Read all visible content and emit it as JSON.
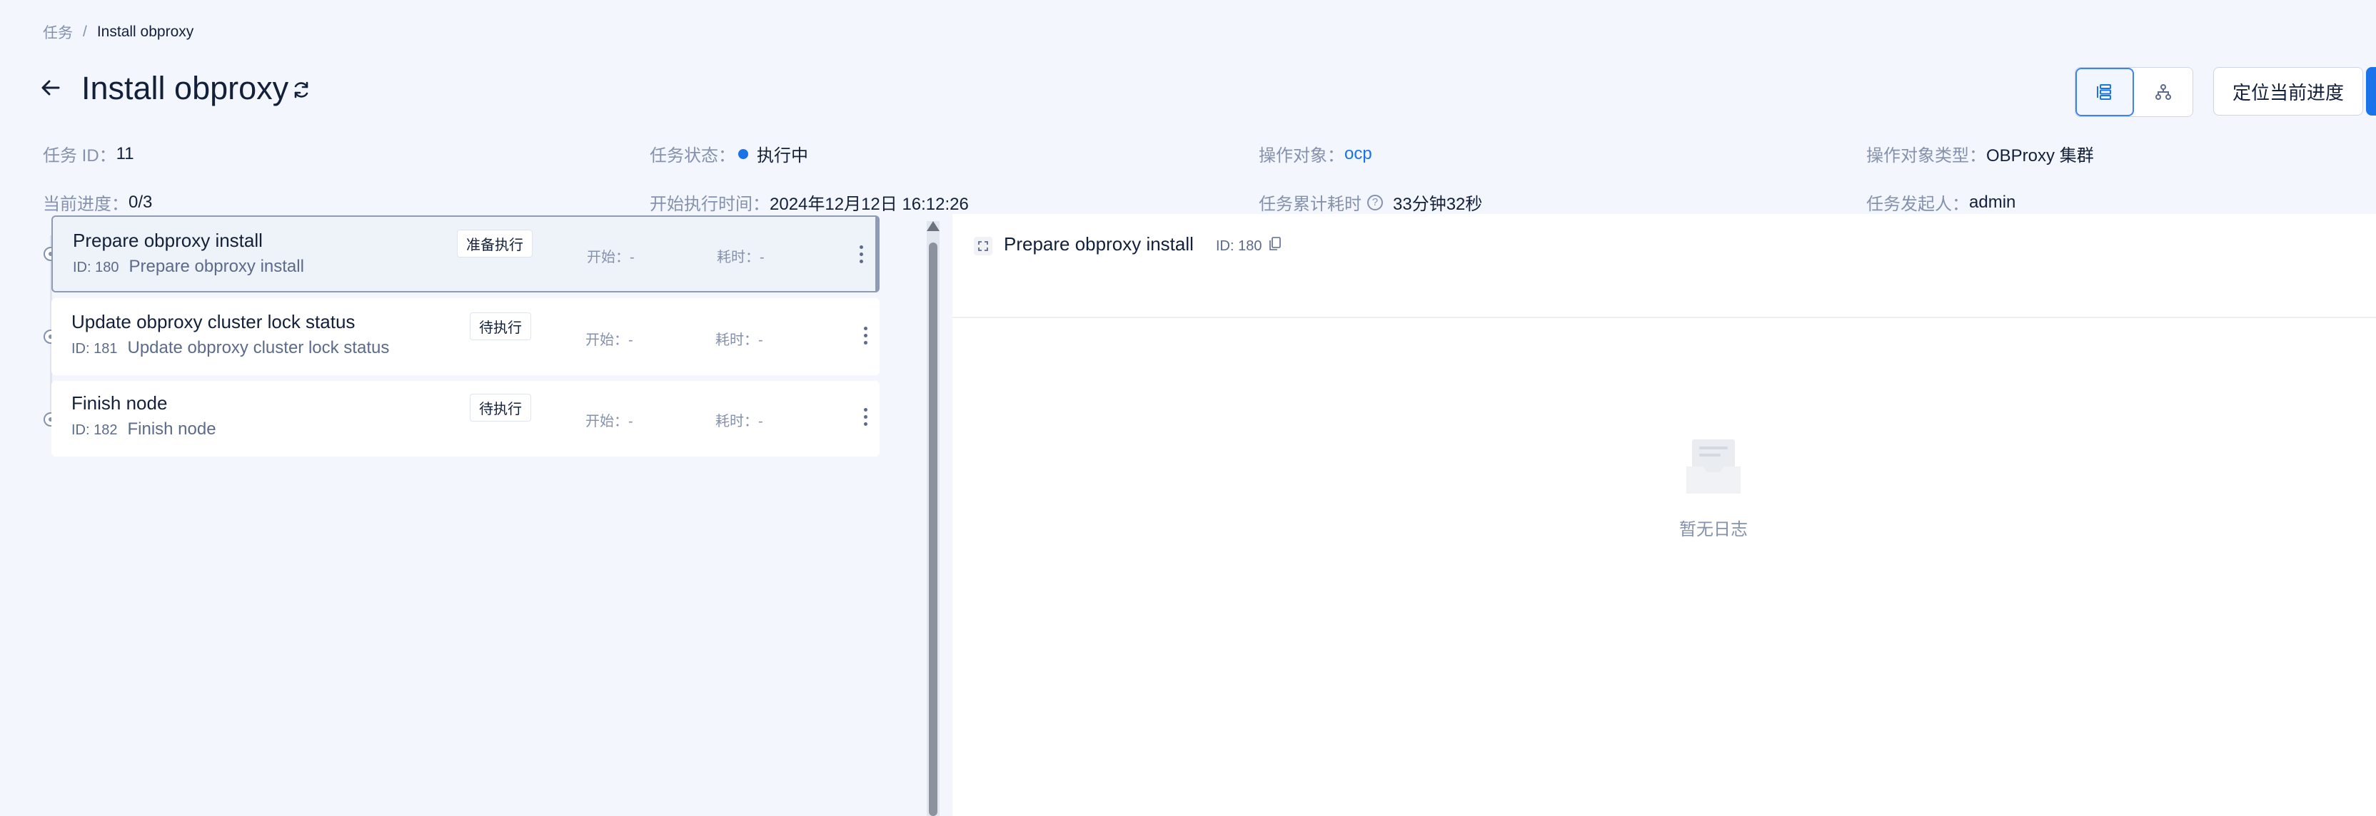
{
  "breadcrumb": {
    "parent": "任务",
    "sep": "/",
    "current": "Install obproxy"
  },
  "header": {
    "title": "Install obproxy",
    "locate_label": "定位当前进度"
  },
  "info": {
    "task_id_label": "任务 ID：",
    "task_id": "11",
    "status_label": "任务状态：",
    "status": "执行中",
    "target_label": "操作对象：",
    "target": "ocp",
    "target_type_label": "操作对象类型：",
    "target_type": "OBProxy 集群",
    "progress_label": "当前进度：",
    "progress": "0/3",
    "start_label": "开始执行时间：",
    "start": "2024年12月12日 16:12:26",
    "elapsed_label": "任务累计耗时",
    "elapsed": "33分钟32秒",
    "initiator_label": "任务发起人：",
    "initiator": "admin"
  },
  "nodes": [
    {
      "name": "Prepare obproxy install",
      "id_label": "ID: 180",
      "desc": "Prepare obproxy install",
      "status": "准备执行",
      "start": "开始：-",
      "duration": "耗时：-"
    },
    {
      "name": "Update obproxy cluster lock status",
      "id_label": "ID: 181",
      "desc": "Update obproxy cluster lock status",
      "status": "待执行",
      "start": "开始：-",
      "duration": "耗时：-"
    },
    {
      "name": "Finish node",
      "id_label": "ID: 182",
      "desc": "Finish node",
      "status": "待执行",
      "start": "开始：-",
      "duration": "耗时：-"
    }
  ],
  "log": {
    "title": "Prepare obproxy install",
    "id_label": "ID: 180",
    "empty": "暂无日志"
  },
  "colors": {
    "primary": "#1a73e8",
    "page_bg": "#f3f6fc",
    "muted": "#8592ad"
  },
  "icons": [
    "back-arrow-icon",
    "refresh-icon",
    "list-view-icon",
    "tree-view-icon",
    "expand-icon",
    "copy-icon",
    "empty-doc-icon",
    "more-icon",
    "help-icon"
  ]
}
